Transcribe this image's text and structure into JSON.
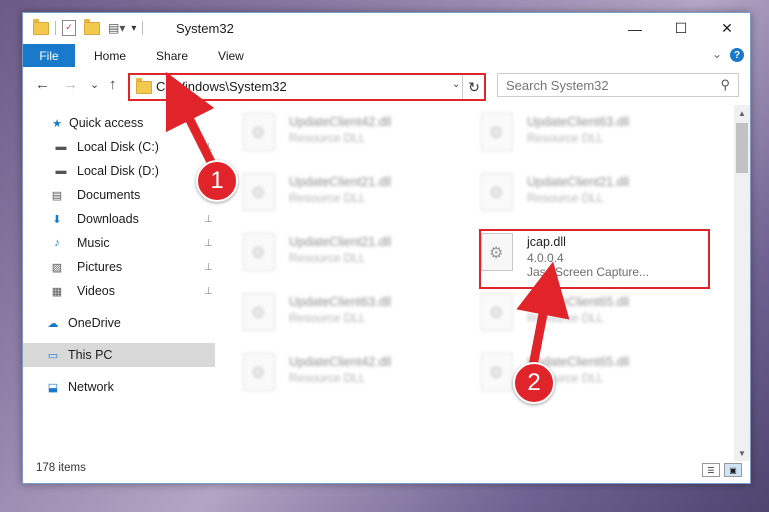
{
  "window": {
    "title": "System32",
    "minimize": "—",
    "maximize": "☐",
    "close": "✕"
  },
  "ribbon": {
    "tabs": [
      "File",
      "Home",
      "Share",
      "View"
    ],
    "help": "?",
    "collapse": "⌄"
  },
  "address": {
    "path": "C:\\Windows\\System32",
    "back": "←",
    "forward": "→",
    "recent": "⌄",
    "up": "↑",
    "refresh": "↻",
    "dropdown": "⌄"
  },
  "search": {
    "placeholder": "Search System32",
    "icon": "⚲"
  },
  "navpane": {
    "items": [
      {
        "label": "Quick access",
        "icon": "star-icon",
        "glyph": "★",
        "pinned": false
      },
      {
        "label": "Local Disk (C:)",
        "icon": "drive-icon",
        "glyph": "▬",
        "pinned": true
      },
      {
        "label": "Local Disk (D:)",
        "icon": "drive-icon",
        "glyph": "▬",
        "pinned": true
      },
      {
        "label": "Documents",
        "icon": "documents-icon",
        "glyph": "▤",
        "pinned": true
      },
      {
        "label": "Downloads",
        "icon": "download-icon",
        "glyph": "⬇",
        "pinned": true
      },
      {
        "label": "Music",
        "icon": "music-icon",
        "glyph": "♪",
        "pinned": true
      },
      {
        "label": "Pictures",
        "icon": "pictures-icon",
        "glyph": "▨",
        "pinned": true
      },
      {
        "label": "Videos",
        "icon": "videos-icon",
        "glyph": "▦",
        "pinned": true
      },
      {
        "label": "OneDrive",
        "icon": "cloud-icon",
        "glyph": "☁",
        "pinned": false
      },
      {
        "label": "This PC",
        "icon": "computer-icon",
        "glyph": "▭",
        "pinned": false,
        "selected": true
      },
      {
        "label": "Network",
        "icon": "network-icon",
        "glyph": "⬓",
        "pinned": false
      }
    ],
    "pin_glyph": "📌"
  },
  "files": [
    {
      "name": "UpdateClient42.dll",
      "type": "Resource DLL"
    },
    {
      "name": "UpdateClient63.dll",
      "type": "Resource DLL"
    },
    {
      "name": "UpdateClient21.dll",
      "type": "Resource DLL"
    },
    {
      "name": "UpdateClient21.dll",
      "type": "Resource DLL"
    },
    {
      "name": "UpdateClient21.dll",
      "type": "Resource DLL"
    },
    {
      "name": "jcap.dll",
      "type": "4.0.0.4",
      "description": "Jasc Screen Capture..."
    },
    {
      "name": "UpdateClient63.dll",
      "type": "Resource DLL"
    },
    {
      "name": "UpdateClient65.dll",
      "type": "Resource DLL"
    },
    {
      "name": "UpdateClient42.dll",
      "type": "Resource DLL"
    },
    {
      "name": "UpdateClient65.dll",
      "type": "Resource DLL"
    }
  ],
  "status": {
    "item_count": "178 items"
  },
  "annotations": {
    "step1": "1",
    "step2": "2",
    "color": "#e0242a"
  }
}
